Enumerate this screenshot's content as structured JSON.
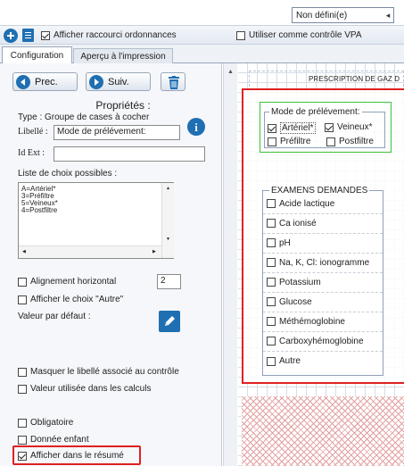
{
  "top_bar": {
    "dropdown_value": "Non défini(e)",
    "dropdown_arrow": "◂"
  },
  "toolbar": {
    "show_shortcut_label": "Afficher raccourci ordonnances",
    "show_shortcut_checked": true,
    "use_vpa_label": "Utiliser comme contrôle VPA",
    "use_vpa_checked": false
  },
  "tabs": [
    {
      "label": "Configuration",
      "active": true
    },
    {
      "label": "Aperçu à l'impression",
      "active": false
    }
  ],
  "nav": {
    "prev_label": "Prec.",
    "next_label": "Suiv."
  },
  "properties": {
    "heading": "Propriétés :",
    "type_text": "Type : Groupe de cases à cocher",
    "label_caption": "Libellé :",
    "label_value": "Mode de prélévement:",
    "id_ext_caption": "Id Ext :",
    "id_ext_value": "",
    "choices_caption": "Liste de choix possibles :",
    "choices": [
      "A=Artériel*",
      "3=Préfiltre",
      "5=Veineux*",
      "4=Postfiltre"
    ],
    "align_label": "Alignement horizontal",
    "align_checked": false,
    "align_value": "2",
    "other_label": "Afficher le choix \"Autre\"",
    "other_checked": false,
    "default_label": "Valeur par défaut :",
    "options": [
      {
        "label": "Masquer le libellé associé au contrôle",
        "checked": false
      },
      {
        "label": "Valeur utilisée dans les calculs",
        "checked": false
      },
      {
        "label": "Obligatoire",
        "checked": false
      },
      {
        "label": "Donnée enfant",
        "checked": false
      },
      {
        "label": "Afficher dans le résumé",
        "checked": true
      }
    ]
  },
  "form": {
    "title": "PRESCRIPTION DE GAZ D",
    "sampling_title": "Mode de prélévement:",
    "sampling_choices": [
      {
        "label": "Artériel*",
        "checked": true
      },
      {
        "label": "Veineux*",
        "checked": true
      },
      {
        "label": "Préfiltre",
        "checked": false
      },
      {
        "label": "Postfiltre",
        "checked": false
      }
    ],
    "exams_title": "EXAMENS DEMANDES",
    "exams": [
      "Acide lactique",
      "Ca ionisé",
      "pH",
      "Na, K, Cl: ionogramme",
      "Potassium",
      "Glucose",
      "Méthémoglobine",
      "Carboxyhémoglobine",
      "Autre"
    ]
  },
  "colors": {
    "accent_blue": "#1f6fb2",
    "highlight_red": "#e02020",
    "highlight_green": "#3cc23c",
    "grid_blue": "#b9c6d8",
    "hatch_red": "#e3a0a0"
  }
}
